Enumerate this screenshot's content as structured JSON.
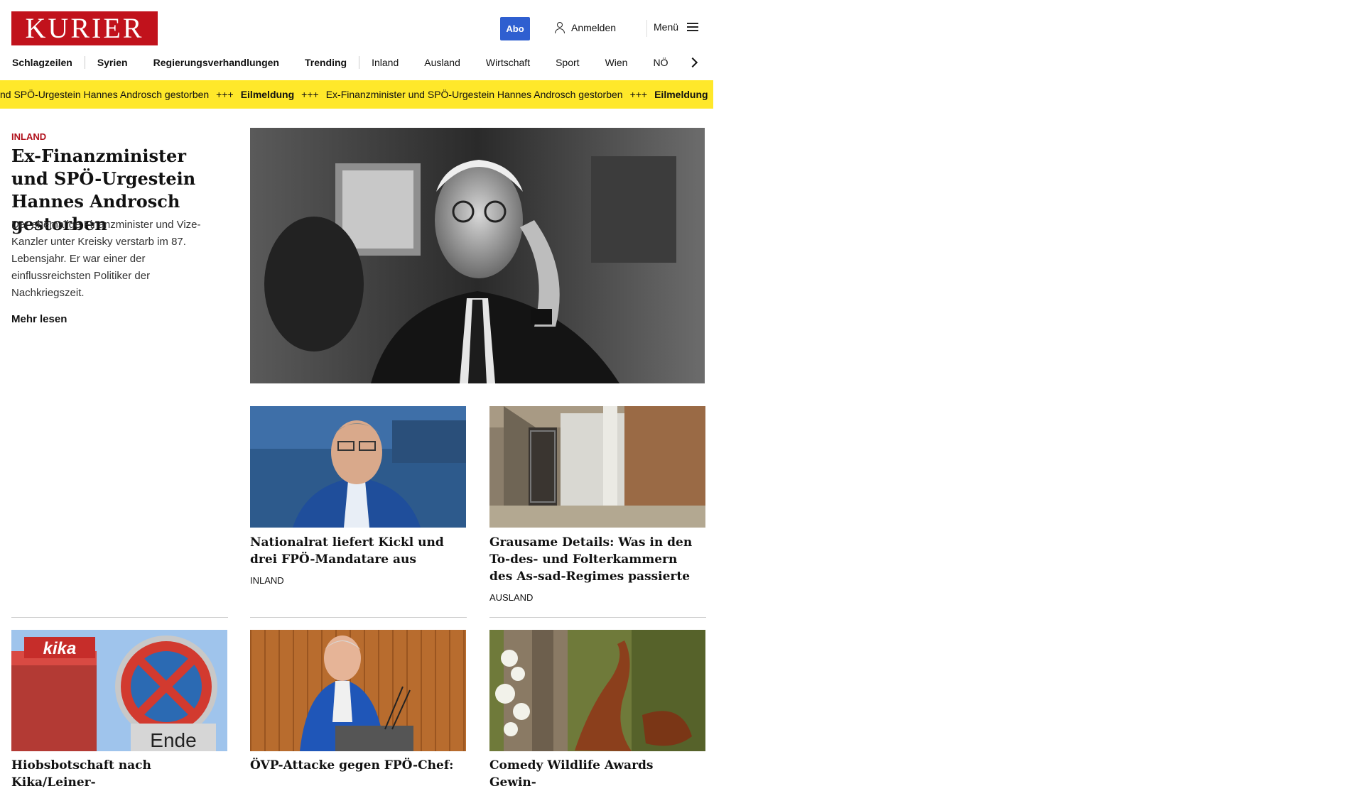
{
  "header": {
    "logo": "KURIER",
    "abo_label": "Abo",
    "login_label": "Anmelden",
    "menu_label": "Menü"
  },
  "nav": {
    "items": [
      {
        "label": "Schlagzeilen"
      },
      {
        "label": "Syrien"
      },
      {
        "label": "Regierungsverhandlungen"
      },
      {
        "label": "Trending"
      },
      {
        "label": "Inland"
      },
      {
        "label": "Ausland"
      },
      {
        "label": "Wirtschaft"
      },
      {
        "label": "Sport"
      },
      {
        "label": "Wien"
      },
      {
        "label": "NÖ"
      }
    ]
  },
  "ticker": {
    "separator": "+++",
    "label": "Eilmeldung",
    "text_partial": "nd SPÖ-Urgestein Hannes Androsch gestorben",
    "text": "Ex-Finanzminister und SPÖ-Urgestein Hannes Androsch gestorben",
    "background": "#ffe82a"
  },
  "lead": {
    "category": "INLAND",
    "title": "Ex-Finanzminister und SPÖ-Urgestein Hannes Androsch gestorben",
    "teaser": "Der ehemalige Finanzminister und Vize-Kanzler unter Kreisky verstarb im 87. Lebensjahr. Er war einer der einflussreichsten Politiker der Nachkriegszeit.",
    "more_label": "Mehr lesen"
  },
  "cards": [
    {
      "title": "Nationalrat liefert Kickl und drei FPÖ-Mandatare aus",
      "category": "INLAND"
    },
    {
      "title": "Grausame Details: Was in den To-des- und Folterkammern des As-sad-Regimes passierte",
      "category": "AUSLAND"
    },
    {
      "title": "Hiobsbotschaft nach Kika/Leiner-"
    },
    {
      "title": "ÖVP-Attacke gegen FPÖ-Chef:"
    },
    {
      "title": "Comedy Wildlife Awards Gewin-"
    }
  ],
  "images": {
    "kika_sign_text": "kika",
    "ende_sign_text": "Ende"
  },
  "colors": {
    "brand_red": "#c1121c",
    "abo_blue": "#2f5fd0",
    "category_red": "#b0101b"
  }
}
